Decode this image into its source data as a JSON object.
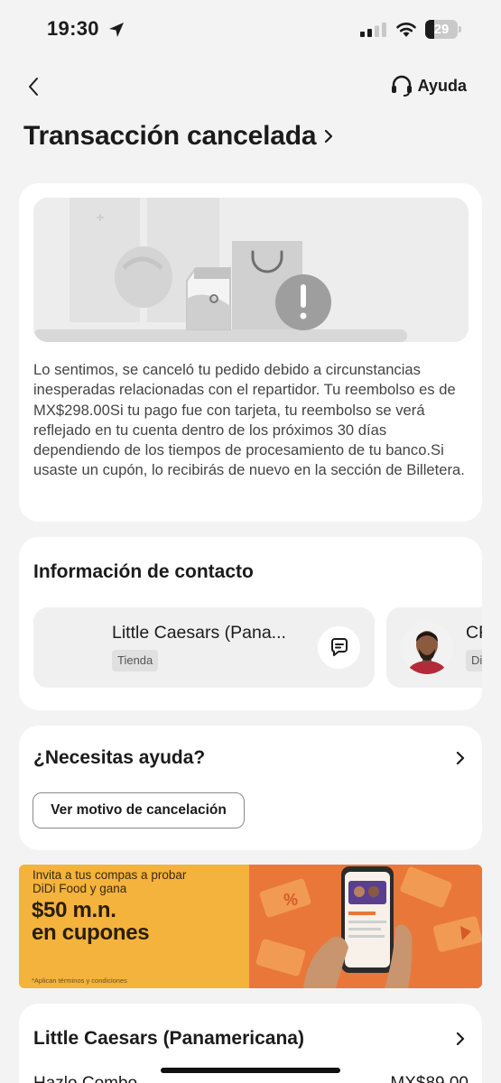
{
  "status_bar": {
    "time": "19:30",
    "battery": "29",
    "battery_fraction": 0.29
  },
  "header": {
    "help_label": "Ayuda",
    "title": "Transacción cancelada"
  },
  "cancel_card": {
    "message": "Lo sentimos, se canceló tu pedido debido a circunstancias inesperadas relacionadas con el repartidor. Tu reembolso es de MX$298.00Si tu pago fue con tarjeta, tu reembolso se verá reflejado en tu cuenta dentro de los próximos 30 días dependiendo de los tiempos de procesamiento de tu banco.Si usaste un cupón, lo recibirás de nuevo en la sección de Billetera."
  },
  "contact": {
    "title": "Información de contacto",
    "store": {
      "name": "Little Caesars (Pana...",
      "badge": "Tienda"
    },
    "courier": {
      "name": "CF",
      "badge": "Di"
    }
  },
  "help_card": {
    "title": "¿Necesitas ayuda?",
    "button_label": "Ver motivo de cancelación"
  },
  "promo": {
    "line1": "Invita a tus compas a probar",
    "line2": "DiDi Food y gana",
    "amount": "$50 m.n.",
    "coupons": "en cupones",
    "terms": "*Aplican términos y condiciones"
  },
  "store_card": {
    "title": "Little Caesars (Panamericana)",
    "item_name": "Hazlo Combo",
    "item_price": "MX$89.00"
  },
  "colors": {
    "promo_yellow": "#f3b33c",
    "promo_orange": "#e9773a"
  }
}
